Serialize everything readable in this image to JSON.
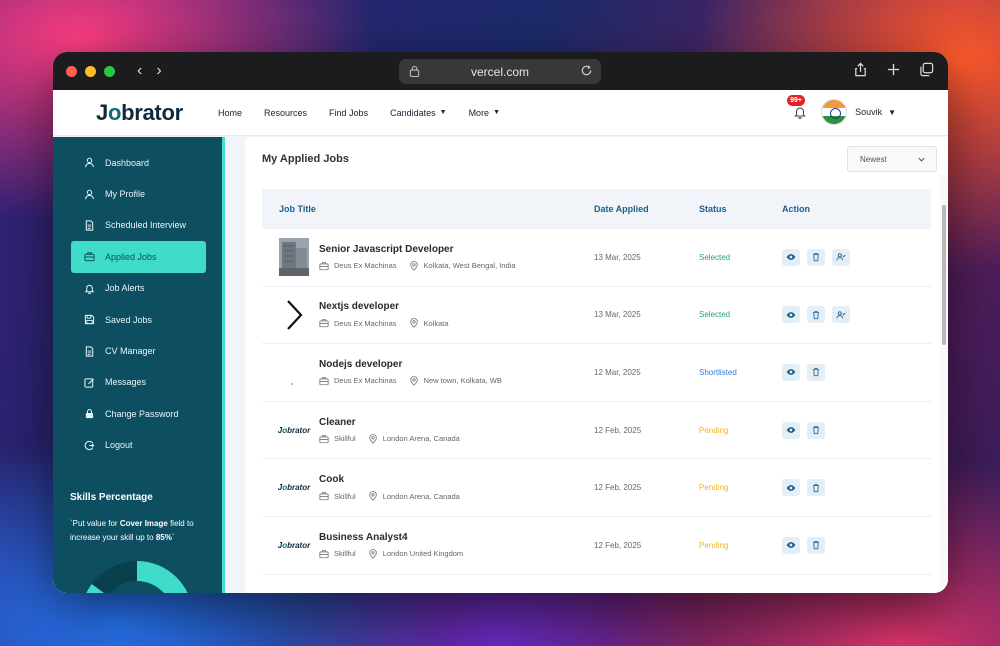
{
  "browser": {
    "url": "vercel.com",
    "traffic_colors": [
      "#ff5f57",
      "#febc2e",
      "#28c840"
    ],
    "back_glyph": "‹",
    "forward_glyph": "›"
  },
  "nav": {
    "logo_left": "J",
    "logo_o": "o",
    "logo_right": "brator",
    "items": [
      "Home",
      "Resources",
      "Find Jobs",
      "Candidates",
      "More"
    ],
    "notification_count": "99+",
    "user_name": "Souvik"
  },
  "sidebar": {
    "items": [
      {
        "label": "Dashboard",
        "icon": "user-icon"
      },
      {
        "label": "My Profile",
        "icon": "user-icon"
      },
      {
        "label": "Scheduled Interview",
        "icon": "document-icon"
      },
      {
        "label": "Applied Jobs",
        "icon": "briefcase-icon"
      },
      {
        "label": "Job Alerts",
        "icon": "bell-icon"
      },
      {
        "label": "Saved Jobs",
        "icon": "save-icon"
      },
      {
        "label": "CV Manager",
        "icon": "document-icon"
      },
      {
        "label": "Messages",
        "icon": "edit-icon"
      },
      {
        "label": "Change Password",
        "icon": "lock-icon"
      },
      {
        "label": "Logout",
        "icon": "logout-icon"
      }
    ],
    "active_index": 3,
    "skills_title": "Skills Percentage",
    "skills_text_pre": "`Put value for ",
    "skills_text_bold": "Cover Image",
    "skills_text_mid": " field to increase your skill up to ",
    "skills_text_pct": "85%",
    "skills_text_post": "`",
    "skill_percent": 85
  },
  "main": {
    "title": "My Applied Jobs",
    "sort_value": "Newest",
    "columns": {
      "title": "Job Title",
      "date": "Date Applied",
      "status": "Status",
      "action": "Action"
    },
    "jobs": [
      {
        "title": "Senior Javascript Developer",
        "company": "Deus Ex Machinas",
        "location": "Kolkata, West Bengal, India",
        "date": "13 Mar, 2025",
        "status": "Selected",
        "thumb": "building",
        "actions": 3
      },
      {
        "title": "Nextjs developer",
        "company": "Deus Ex Machinas",
        "location": "Kolkata",
        "date": "13 Mar, 2025",
        "status": "Selected",
        "thumb": "chevron",
        "actions": 3
      },
      {
        "title": "Nodejs developer",
        "company": "Deus Ex Machinas",
        "location": "New town, Kolkata, WB",
        "date": "12 Mar, 2025",
        "status": "Shortlisted",
        "thumb": "blank",
        "actions": 2
      },
      {
        "title": "Cleaner",
        "company": "Skillful",
        "location": "London Arena, Canada",
        "date": "12 Feb, 2025",
        "status": "Pending",
        "thumb": "logo",
        "actions": 2
      },
      {
        "title": "Cook",
        "company": "Skillful",
        "location": "London Arena, Canada",
        "date": "12 Feb, 2025",
        "status": "Pending",
        "thumb": "logo",
        "actions": 2
      },
      {
        "title": "Business Analyst4",
        "company": "Skillful",
        "location": "London United Kingdom",
        "date": "12 Feb, 2025",
        "status": "Pending",
        "thumb": "logo",
        "actions": 2
      }
    ],
    "status_colors": {
      "Selected": "#2a9d78",
      "Shortlisted": "#2f7fe0",
      "Pending": "#f0b429"
    }
  }
}
